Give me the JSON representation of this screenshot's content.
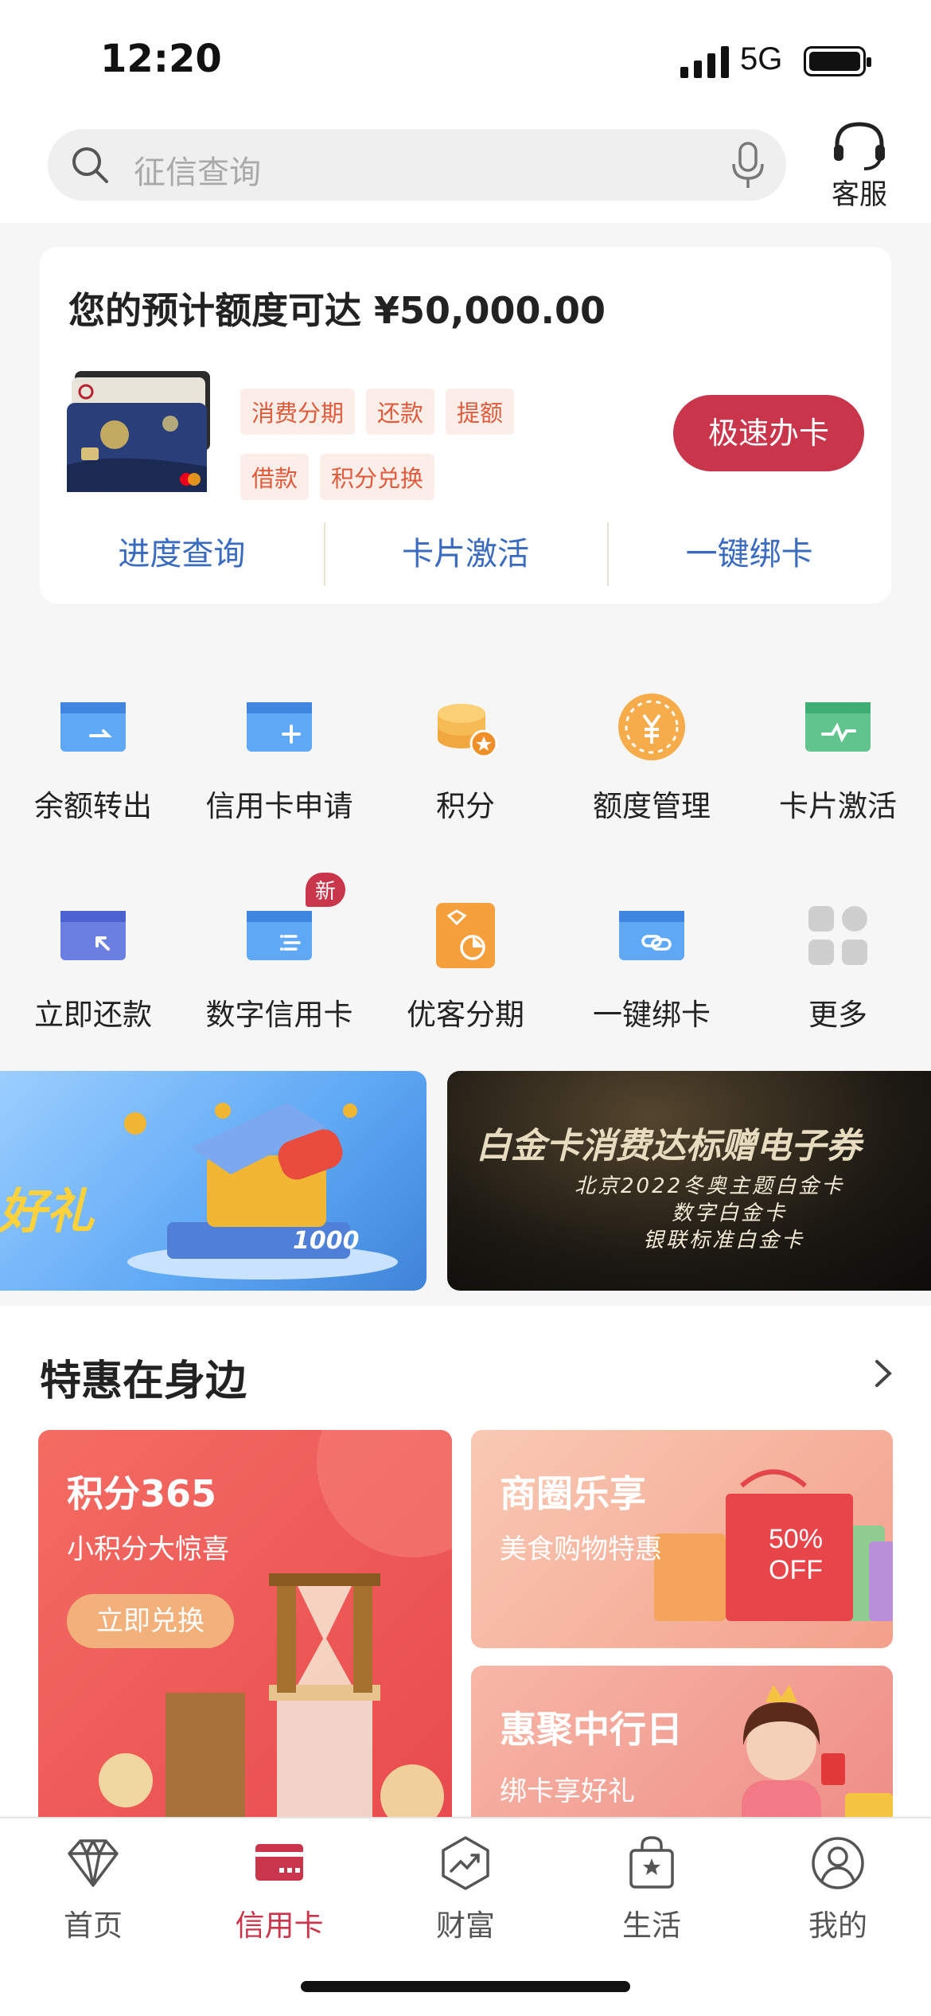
{
  "status_bar": {
    "time": "12:20",
    "network": "5G"
  },
  "header": {
    "search_placeholder": "征信查询",
    "service_label": "客服"
  },
  "credit_panel": {
    "quota_text": "您的预计额度可达 ¥50,000.00",
    "tags": [
      "消费分期",
      "还款",
      "提额",
      "借款",
      "积分兑换"
    ],
    "apply_button": "极速办卡",
    "links": [
      "进度查询",
      "卡片激活",
      "一键绑卡"
    ]
  },
  "grid": {
    "items": [
      {
        "label": "余额转出",
        "icon": "transfer-out-card-icon"
      },
      {
        "label": "信用卡申请",
        "icon": "card-apply-icon"
      },
      {
        "label": "积分",
        "icon": "points-coins-icon"
      },
      {
        "label": "额度管理",
        "icon": "quota-yuan-icon"
      },
      {
        "label": "卡片激活",
        "icon": "card-activate-icon"
      },
      {
        "label": "立即还款",
        "icon": "repay-card-icon"
      },
      {
        "label": "数字信用卡",
        "icon": "digital-card-icon",
        "badge": "新"
      },
      {
        "label": "优客分期",
        "icon": "installment-icon"
      },
      {
        "label": "一键绑卡",
        "icon": "bind-card-icon"
      },
      {
        "label": "更多",
        "icon": "more-grid-icon"
      }
    ]
  },
  "banners": {
    "left_text": "好礼",
    "left_amount": "1000",
    "right_title": "白金卡消费达标赠电子券",
    "right_lines": [
      "北京2022冬奥主题白金卡",
      "数字白金卡",
      "银联标准白金卡"
    ]
  },
  "offers": {
    "title": "特惠在身边",
    "main": {
      "title": "积分365",
      "subtitle": "小积分大惊喜",
      "button": "立即兑换"
    },
    "card_a": {
      "title": "商圈乐享",
      "subtitle": "美食购物特惠",
      "badge": "50% OFF"
    },
    "card_b": {
      "title": "惠聚中行日",
      "subtitle": "绑卡享好礼"
    }
  },
  "tabbar": {
    "tabs": [
      {
        "label": "首页",
        "icon": "diamond-icon"
      },
      {
        "label": "信用卡",
        "icon": "credit-card-icon",
        "active": true
      },
      {
        "label": "财富",
        "icon": "wealth-chart-icon"
      },
      {
        "label": "生活",
        "icon": "life-bag-icon"
      },
      {
        "label": "我的",
        "icon": "profile-icon"
      }
    ]
  },
  "colors": {
    "brand_red": "#c9354a",
    "link_blue": "#3a6bbf",
    "tag_orange": "#e05a3c"
  }
}
